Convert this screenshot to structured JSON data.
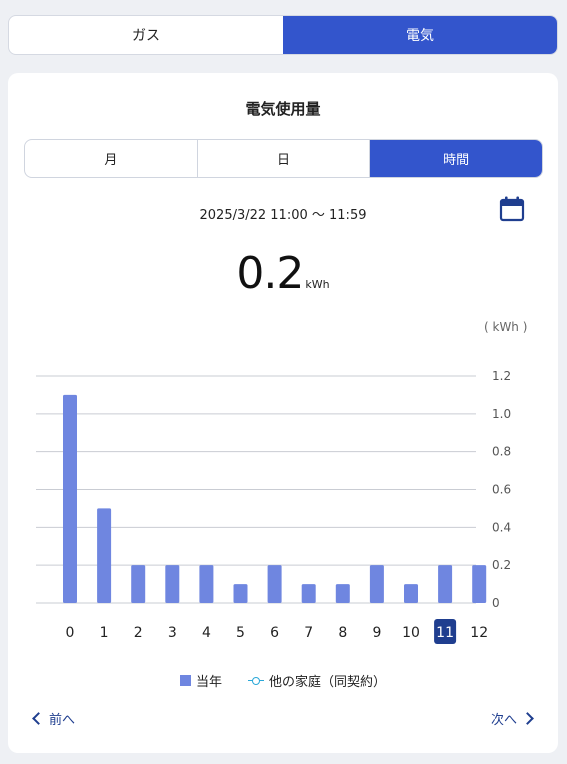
{
  "top_tabs": [
    {
      "label": "ガス",
      "active": false
    },
    {
      "label": "電気",
      "active": true
    }
  ],
  "card": {
    "title": "電気使用量",
    "segments": [
      {
        "label": "月",
        "active": false
      },
      {
        "label": "日",
        "active": false
      },
      {
        "label": "時間",
        "active": true
      }
    ],
    "date_range": "2025/3/22 11:00 〜 11:59",
    "usage_value": "0.2",
    "usage_unit": "kWh",
    "unit_label": "( kWh )"
  },
  "legend": {
    "current_year": "当年",
    "other_households": "他の家庭（同契約）"
  },
  "nav": {
    "prev": "前へ",
    "next": "次へ"
  },
  "colors": {
    "accent": "#3355cc",
    "bar": "#6f86e0",
    "selected_tick": "#1f3e8f",
    "nav_text": "#1f3e8f"
  },
  "chart_data": {
    "type": "bar",
    "categories": [
      "0",
      "1",
      "2",
      "3",
      "4",
      "5",
      "6",
      "7",
      "8",
      "9",
      "10",
      "11",
      "12"
    ],
    "series": [
      {
        "name": "当年",
        "values": [
          1.1,
          0.5,
          0.2,
          0.2,
          0.2,
          0.1,
          0.2,
          0.1,
          0.1,
          0.2,
          0.1,
          0.2,
          0.2
        ]
      }
    ],
    "y_ticks": [
      "0",
      "0.2",
      "0.4",
      "0.6",
      "0.8",
      "1.0",
      "1.2"
    ],
    "ylim": [
      0,
      1.2
    ],
    "ylabel": "( kWh )",
    "selected_category": "11",
    "grid": true,
    "legend_position": "bottom-center"
  }
}
